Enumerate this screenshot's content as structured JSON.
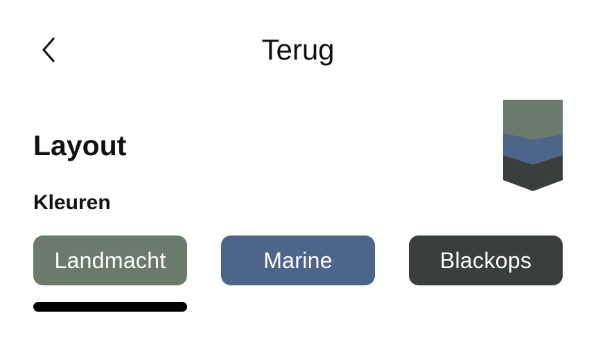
{
  "header": {
    "title": "Terug",
    "back_icon": "chevron-left-icon"
  },
  "page": {
    "title": "Layout",
    "section_title": "Kleuren"
  },
  "emblem": {
    "icon": "rank-chevron-icon",
    "colors": [
      "#6b7a6a",
      "#4d658a",
      "#3b3f3c"
    ]
  },
  "themes": [
    {
      "label": "Landmacht",
      "color": "#6b7a6a",
      "selected": true
    },
    {
      "label": "Marine",
      "color": "#4d658a",
      "selected": false
    },
    {
      "label": "Blackops",
      "color": "#3b3f3c",
      "selected": false
    }
  ]
}
